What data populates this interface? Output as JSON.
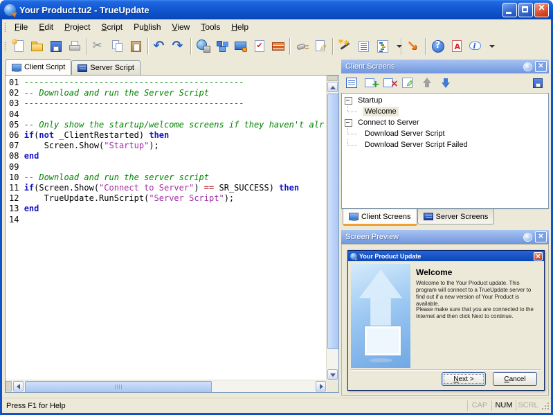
{
  "window": {
    "title": "Your Product.tu2 - TrueUpdate"
  },
  "menu": {
    "items": [
      {
        "label": "File",
        "accel": 0
      },
      {
        "label": "Edit",
        "accel": 0
      },
      {
        "label": "Project",
        "accel": 0
      },
      {
        "label": "Script",
        "accel": 0
      },
      {
        "label": "Publish",
        "accel": 2
      },
      {
        "label": "View",
        "accel": 0
      },
      {
        "label": "Tools",
        "accel": 0
      },
      {
        "label": "Help",
        "accel": 0
      }
    ]
  },
  "toolbar": {
    "items": [
      {
        "name": "new"
      },
      {
        "name": "open"
      },
      {
        "name": "save"
      },
      {
        "name": "print"
      },
      {
        "sep": true
      },
      {
        "name": "cut"
      },
      {
        "name": "copy"
      },
      {
        "name": "paste"
      },
      {
        "sep": true
      },
      {
        "name": "undo"
      },
      {
        "name": "redo"
      },
      {
        "sep": true
      },
      {
        "name": "globe-server"
      },
      {
        "name": "blocks"
      },
      {
        "name": "screen-designer"
      },
      {
        "name": "checklist"
      },
      {
        "name": "build-bricks"
      },
      {
        "sep": true
      },
      {
        "name": "plugin"
      },
      {
        "name": "edit-script"
      },
      {
        "sep": true
      },
      {
        "name": "wizard"
      },
      {
        "name": "script-list"
      },
      {
        "name": "outline"
      },
      {
        "name": "outline-dropdown",
        "dropdown": true
      },
      {
        "sep": true
      },
      {
        "name": "publish"
      },
      {
        "sep": true
      },
      {
        "name": "help"
      },
      {
        "name": "pdf"
      },
      {
        "name": "info"
      },
      {
        "name": "toolbar-overflow",
        "dropdown": true
      }
    ]
  },
  "editor_tabs": [
    {
      "label": "Client Script",
      "icon": "monitor",
      "active": true
    },
    {
      "label": "Server Script",
      "icon": "server",
      "active": false
    }
  ],
  "editor": {
    "lines": [
      {
        "num": "01",
        "tokens": [
          [
            "c",
            "--------------------------------------------"
          ]
        ]
      },
      {
        "num": "02",
        "tokens": [
          [
            "c",
            "-- Download and run the Server Script"
          ]
        ]
      },
      {
        "num": "03",
        "tokens": [
          [
            "c",
            "--------------------------------------------"
          ]
        ]
      },
      {
        "num": "04",
        "tokens": []
      },
      {
        "num": "05",
        "tokens": [
          [
            "c",
            "-- Only show the startup/welcome screens if they haven't alr"
          ]
        ]
      },
      {
        "num": "06",
        "tokens": [
          [
            "k",
            "if"
          ],
          [
            "p",
            "("
          ],
          [
            "k",
            "not"
          ],
          [
            "p",
            " _ClientRestarted) "
          ],
          [
            "k",
            "then"
          ]
        ]
      },
      {
        "num": "07",
        "tokens": [
          [
            "p",
            "    Screen.Show("
          ],
          [
            "s",
            "\"Startup\""
          ],
          [
            "p",
            ");"
          ]
        ]
      },
      {
        "num": "08",
        "tokens": [
          [
            "k",
            "end"
          ]
        ]
      },
      {
        "num": "09",
        "tokens": []
      },
      {
        "num": "10",
        "tokens": [
          [
            "c",
            "-- Download and run the server script"
          ]
        ]
      },
      {
        "num": "11",
        "tokens": [
          [
            "k",
            "if"
          ],
          [
            "p",
            "(Screen.Show("
          ],
          [
            "s",
            "\"Connect to Server\""
          ],
          [
            "p",
            ") "
          ],
          [
            "o",
            "=="
          ],
          [
            "p",
            " SR_SUCCESS) "
          ],
          [
            "k",
            "then"
          ]
        ]
      },
      {
        "num": "12",
        "tokens": [
          [
            "p",
            "    TrueUpdate.RunScript("
          ],
          [
            "s",
            "\"Server Script\""
          ],
          [
            "p",
            ");"
          ]
        ]
      },
      {
        "num": "13",
        "tokens": [
          [
            "k",
            "end"
          ]
        ]
      },
      {
        "num": "14",
        "tokens": []
      }
    ]
  },
  "client_screens": {
    "title": "Client Screens",
    "toolbar": [
      {
        "name": "screens-list"
      },
      {
        "name": "add-screen"
      },
      {
        "name": "remove-screen"
      },
      {
        "name": "edit-screen"
      },
      {
        "name": "move-up",
        "disabled": true
      },
      {
        "name": "move-down"
      },
      {
        "spacer": true
      },
      {
        "name": "save-screens"
      }
    ],
    "tree": [
      {
        "label": "Startup",
        "children": [
          {
            "label": "Welcome",
            "selected": true
          }
        ]
      },
      {
        "label": "Connect to Server",
        "children": [
          {
            "label": "Download Server Script"
          },
          {
            "label": "Download Server Script Failed"
          }
        ]
      }
    ],
    "tabs": [
      {
        "label": "Client Screens",
        "icon": "monitor",
        "active": true
      },
      {
        "label": "Server Screens",
        "icon": "server",
        "active": false
      }
    ]
  },
  "screen_preview": {
    "title": "Screen Preview",
    "dialog": {
      "title": "Your Product Update",
      "heading": "Welcome",
      "para1": "Welcome to the Your Product update. This program will connect to a TrueUpdate server to find out if a new version of Your Product is available.",
      "para2": "Please make sure that you are connected to the Internet and then click Next to continue.",
      "buttons": [
        {
          "label": "Next >",
          "accel": 0,
          "default": true
        },
        {
          "label": "Cancel",
          "accel": 0,
          "default": false
        }
      ]
    }
  },
  "status_bar": {
    "message": "Press F1 for Help",
    "indicators": [
      {
        "label": "CAP",
        "active": false
      },
      {
        "label": "NUM",
        "active": true
      },
      {
        "label": "SCRL",
        "active": false
      }
    ]
  },
  "colors": {
    "titlebar_blue": "#1259d2",
    "panel_header_blue": "#6f96de",
    "comment_green": "#008200",
    "keyword_blue": "#1414c8",
    "string_purple": "#a32ea3",
    "active_tab_accent_orange": "#f0a030",
    "chrome_tan": "#ece9d8"
  }
}
